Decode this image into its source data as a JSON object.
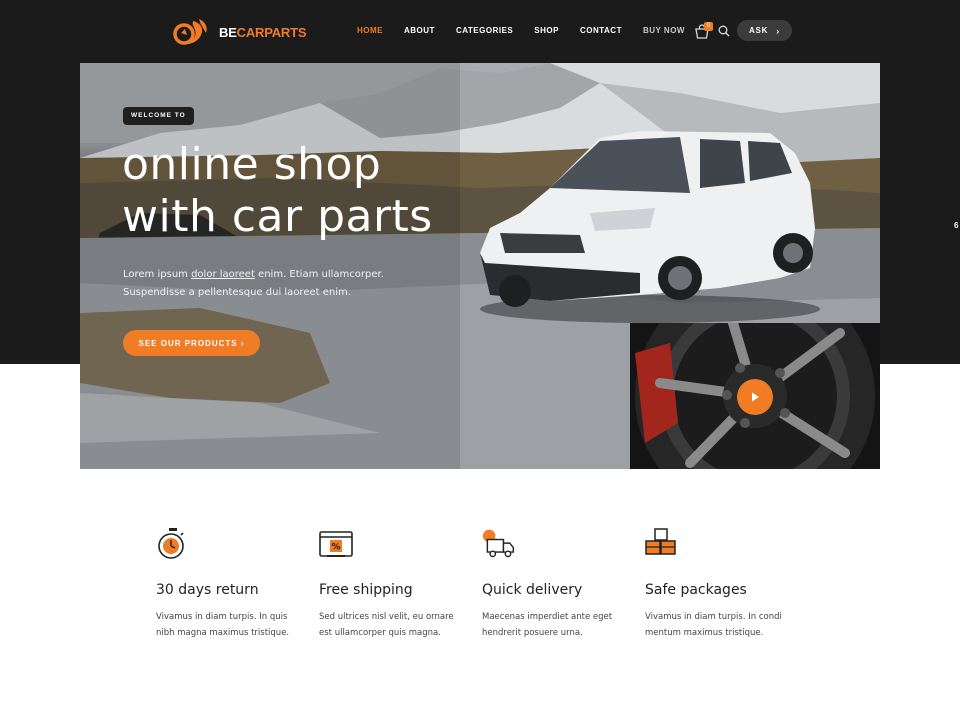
{
  "brand": {
    "logo_prefix": "BE",
    "logo_suffix": "CARPARTS",
    "accent_color": "#f07c26",
    "dark_color": "#1b1b1b"
  },
  "nav": {
    "items": [
      {
        "label": "HOME"
      },
      {
        "label": "ABOUT"
      },
      {
        "label": "CATEGORIES"
      },
      {
        "label": "SHOP"
      },
      {
        "label": "CONTACT"
      },
      {
        "label": "BUY NOW"
      }
    ],
    "cart_count": "0",
    "ask_label": "ASK",
    "ask_chevron": "›"
  },
  "hero": {
    "badge": "WELCOME TO",
    "title_line1": "online shop",
    "title_line2": "with car parts",
    "desc_part1": "Lorem ipsum ",
    "desc_link": "dolor laoreet",
    "desc_part2": " enim. Etiam ullamcorper.",
    "desc_line2": "Suspendisse a pellentesque dui laoreet enim.",
    "cta_label": "SEE OUR PRODUCTS ›",
    "side_tab_text": "6"
  },
  "features": [
    {
      "icon": "stopwatch-icon",
      "title": "30 days return",
      "text": "Vivamus in diam turpis. In quis nibh magna maximus tristique."
    },
    {
      "icon": "laptop-percent-icon",
      "title": "Free shipping",
      "text": "Sed ultrices nisl velit, eu ornare est ullamcorper quis magna."
    },
    {
      "icon": "truck-icon",
      "title": "Quick delivery",
      "text": "Maecenas imperdiet ante eget hendrerit posuere urna."
    },
    {
      "icon": "boxes-icon",
      "title": "Safe packages",
      "text": "Vivamus in diam turpis. In condi mentum maximus tristique."
    }
  ]
}
